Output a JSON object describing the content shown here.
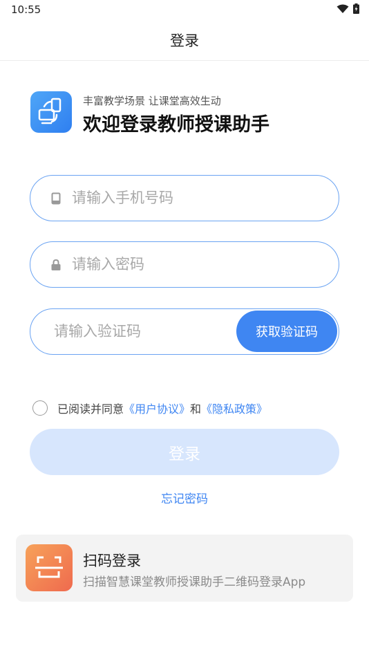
{
  "status_bar": {
    "time": "10:55",
    "icons": [
      "wifi-icon",
      "battery-icon"
    ]
  },
  "nav": {
    "title": "登录"
  },
  "brand": {
    "subtitle": "丰富教学场景 让课堂高效生动",
    "title": "欢迎登录教师授课助手",
    "logo_icon": "devices-icon"
  },
  "form": {
    "phone_placeholder": "请输入手机号码",
    "password_placeholder": "请输入密码",
    "code_placeholder": "请输入验证码",
    "get_code_label": "获取验证码"
  },
  "agreement": {
    "prefix": "已阅读并同意",
    "user_agreement": "《用户协议》",
    "and": "和",
    "privacy_policy": "《隐私政策》"
  },
  "login_label": "登录",
  "forgot_password": "忘记密码",
  "scan_login": {
    "title": "扫码登录",
    "subtitle": "扫描智慧课堂教师授课助手二维码登录App",
    "icon": "scan-icon"
  },
  "colors": {
    "accent": "#3f86f2",
    "field_border": "#6aa3f2",
    "login_disabled": "#d7e6fd",
    "scan_icon": "#f0784f"
  }
}
